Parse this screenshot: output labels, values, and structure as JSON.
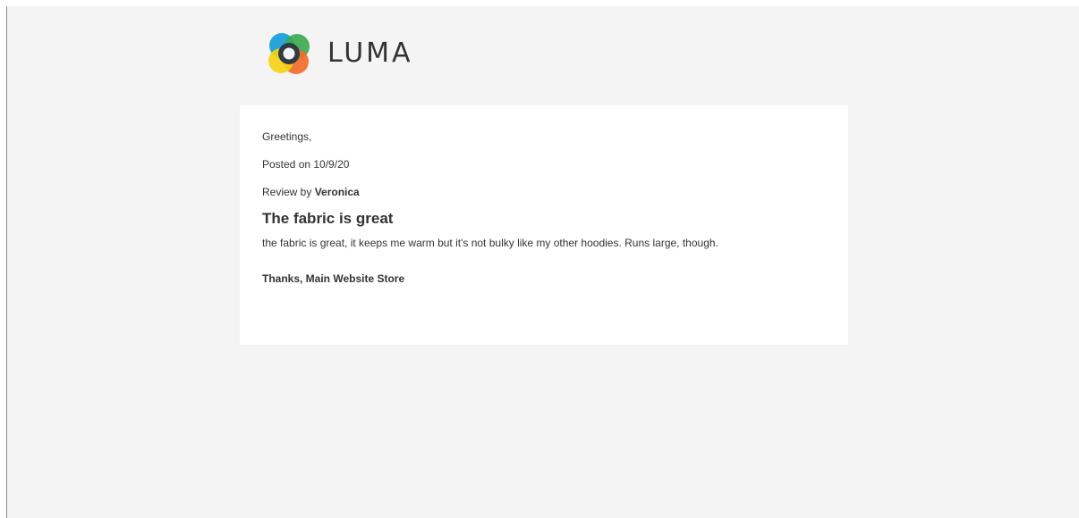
{
  "brand": {
    "name": "LUMA",
    "colors": {
      "blue": "#1a9fd9",
      "green": "#3aa84e",
      "orange": "#f26b2a",
      "yellow": "#f5d310",
      "ring": "#2f3a45"
    }
  },
  "email": {
    "greeting": "Greetings,",
    "posted": "Posted on 10/9/20",
    "review_prefix": "Review by ",
    "reviewer": "Veronica",
    "review_title": "The fabric is great",
    "review_body": "the fabric is great, it keeps me warm but it's not bulky like my other hoodies. Runs large, though.",
    "signoff": "Thanks, Main Website Store"
  }
}
